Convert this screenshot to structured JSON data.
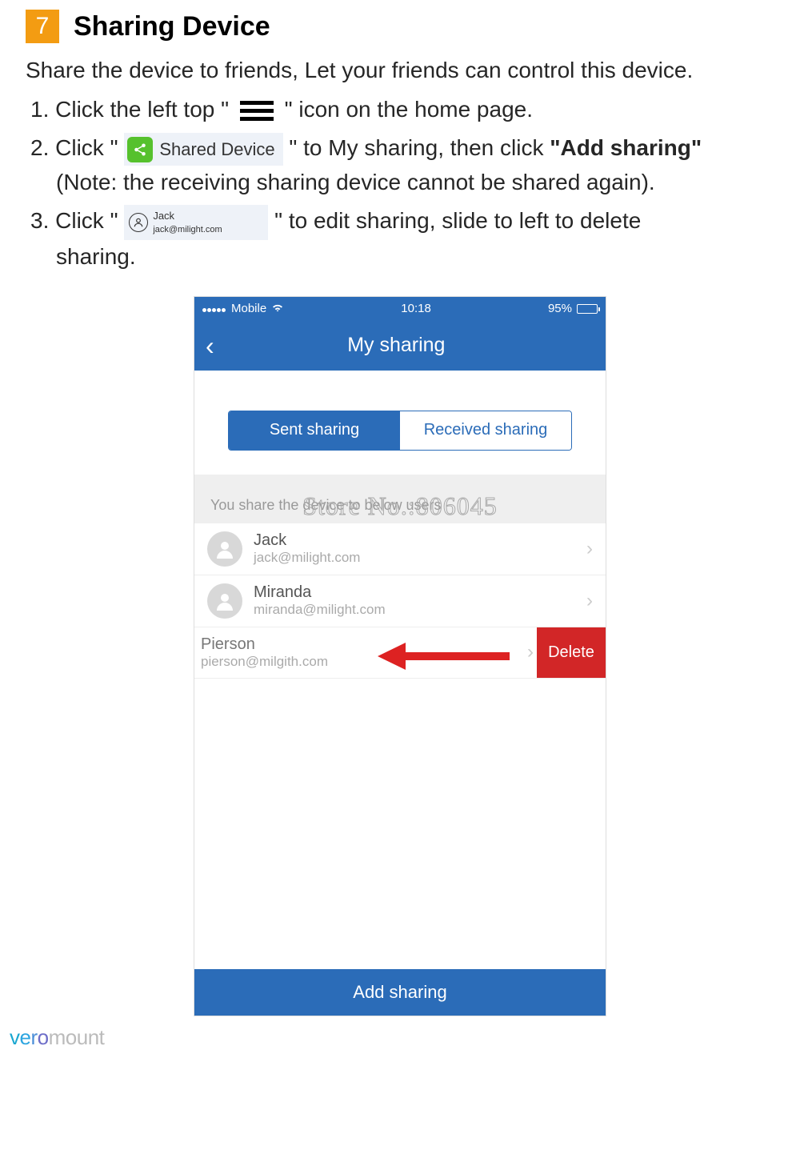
{
  "section": {
    "number": "7",
    "title": "Sharing Device"
  },
  "intro": "Share the device to friends, Let your friends can control this device.",
  "steps": {
    "s1": {
      "num": "1.",
      "a": "Click the left top \"",
      "b": "\" icon on the home page."
    },
    "s2": {
      "num": "2.",
      "a": "Click \"",
      "badge": "Shared Device",
      "b": "\" to My sharing, then click",
      "c": "\"Add sharing\"",
      "note": "(Note: the receiving sharing device cannot be shared again)."
    },
    "s3": {
      "num": "3.",
      "a": "Click \"",
      "chip": {
        "name": "Jack",
        "email": "jack@milight.com"
      },
      "b": "\" to edit sharing, slide to left to delete",
      "cont": "sharing."
    }
  },
  "phone": {
    "status": {
      "carrier": "Mobile",
      "time": "10:18",
      "battery": "95%"
    },
    "nav": {
      "title": "My sharing"
    },
    "tabs": {
      "sent": "Sent sharing",
      "received": "Received sharing"
    },
    "listHeader": "You share the device to below users",
    "users": [
      {
        "name": "Jack",
        "email": "jack@milight.com"
      },
      {
        "name": "Miranda",
        "email": "miranda@milight.com"
      }
    ],
    "swiped": {
      "name": "Pierson",
      "email": "pierson@milgith.com",
      "delete": "Delete"
    },
    "addButton": "Add sharing"
  },
  "watermark": "Store No.:806045",
  "brand": {
    "p1": "v",
    "p2": "e",
    "p3": "r",
    "p4": "o",
    "p5": "mount"
  }
}
